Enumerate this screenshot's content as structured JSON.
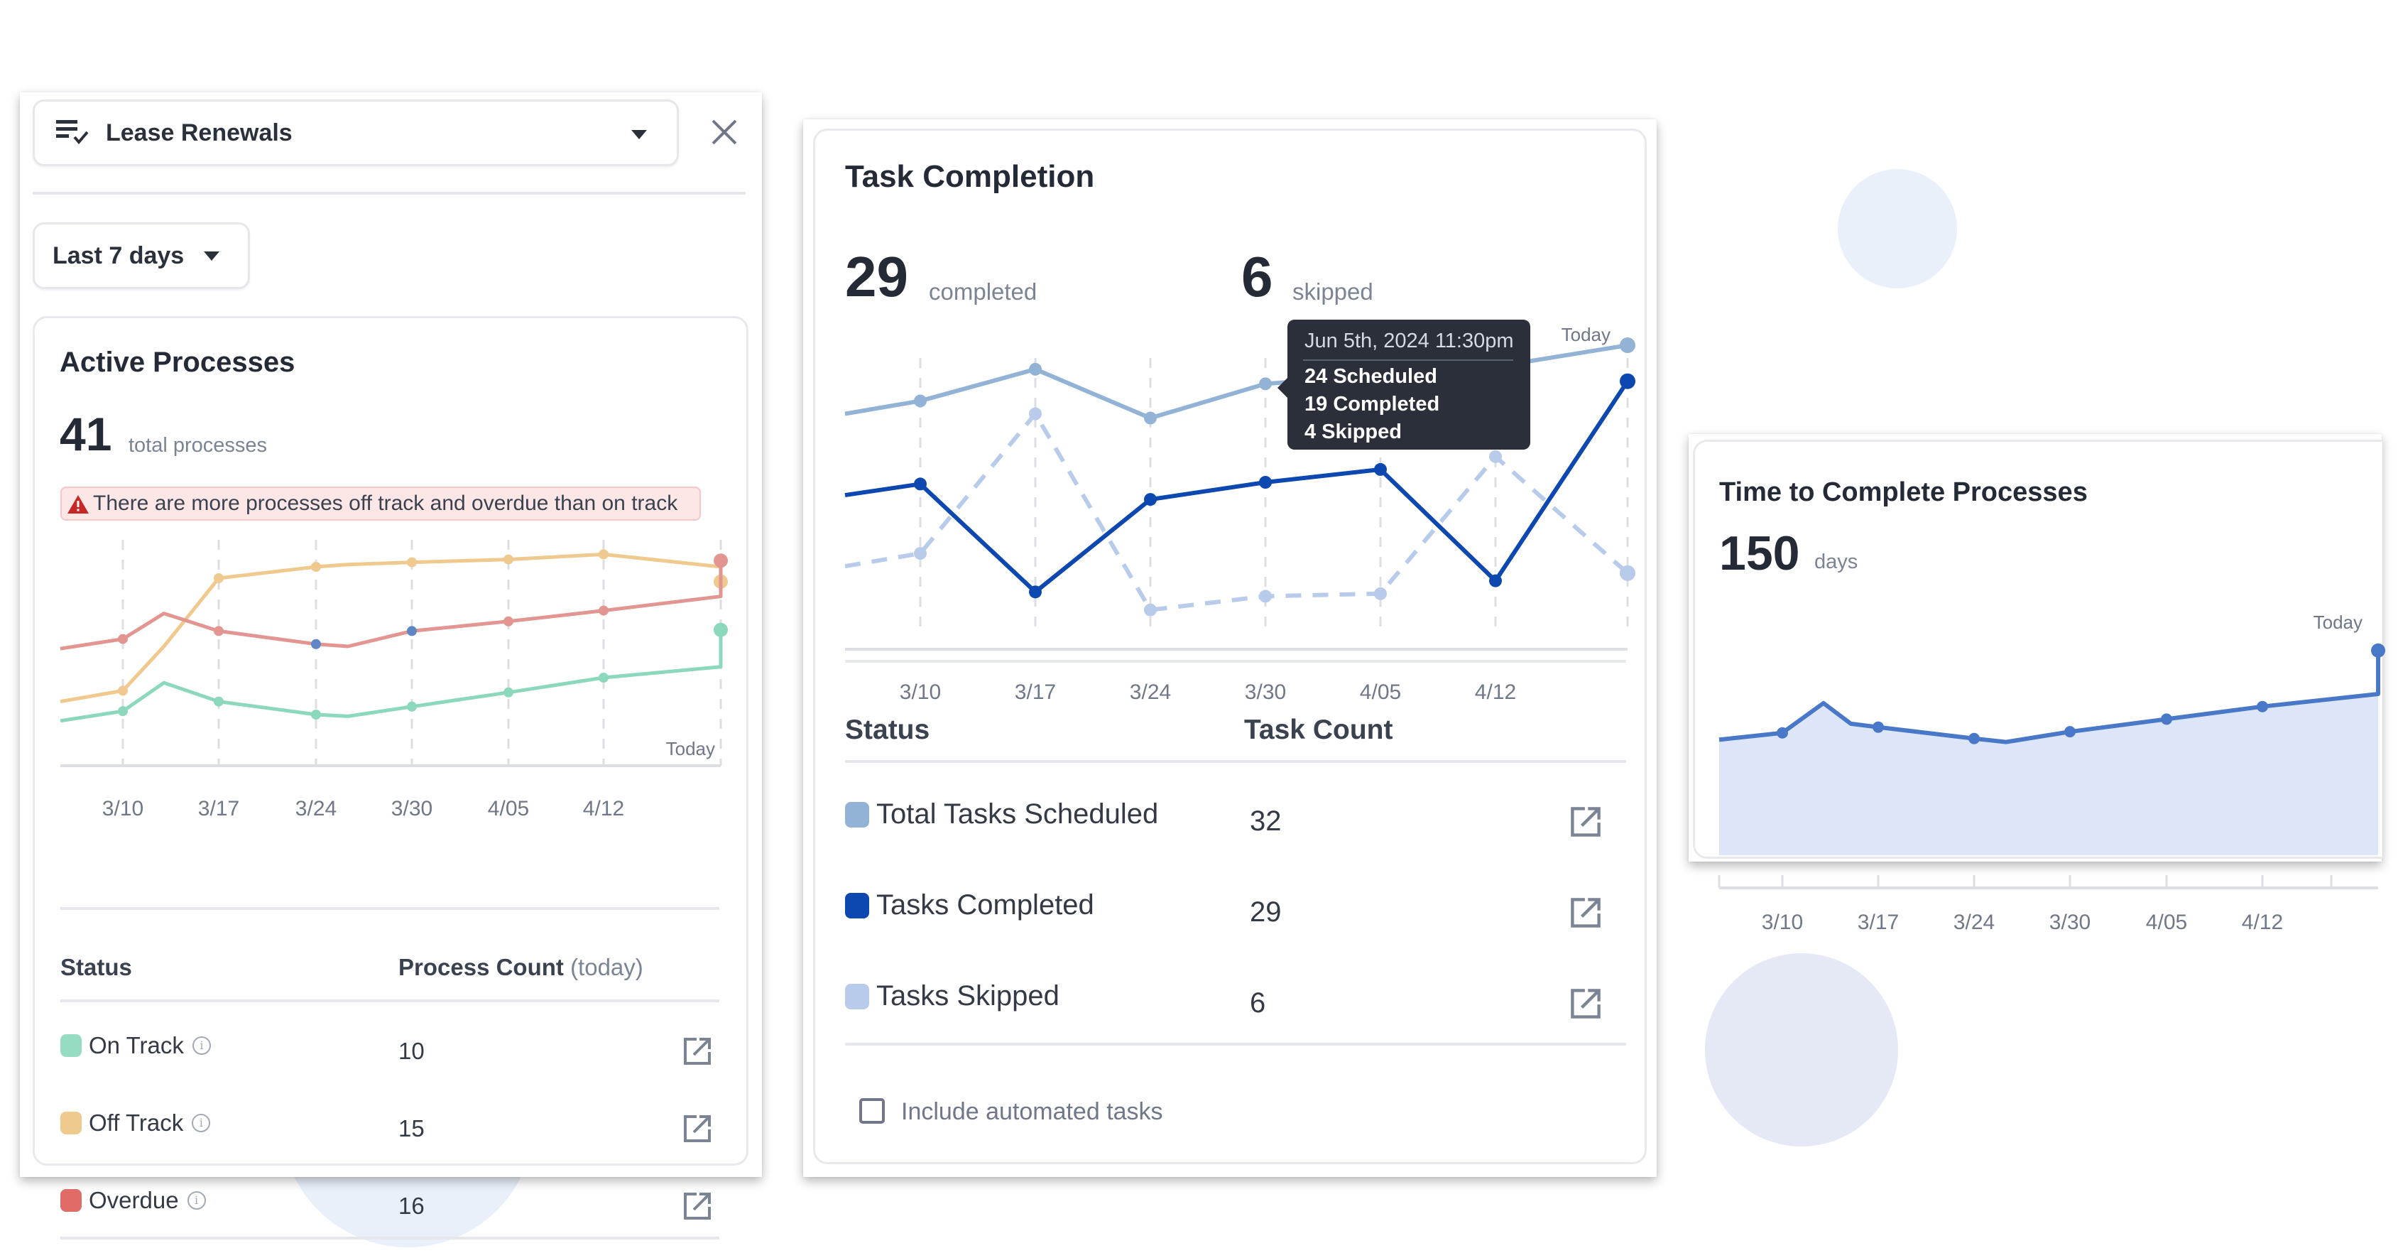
{
  "background": {
    "circle_color_a": "#e9f0fa",
    "circle_color_b": "#e4e9f5"
  },
  "left_panel": {
    "process_select": {
      "icon": "checklist-icon",
      "value": "Lease Renewals"
    },
    "close_icon": "close-icon",
    "range_select": {
      "value": "Last 7 days"
    },
    "active_processes": {
      "title": "Active Processes",
      "total_value": "41",
      "total_unit": "total processes",
      "alert": {
        "icon": "warning-triangle-icon",
        "text": "There are more processes off track and overdue than on track",
        "icon_color": "#c62828"
      },
      "table": {
        "headers": {
          "status": "Status",
          "count": "Process Count",
          "count_suffix": "(today)"
        },
        "rows": [
          {
            "label": "On Track",
            "count": "10",
            "color": "#96dcc1"
          },
          {
            "label": "Off Track",
            "count": "15",
            "color": "#f0c98e"
          },
          {
            "label": "Overdue",
            "count": "16",
            "color": "#e06b67"
          }
        ]
      }
    }
  },
  "middle_panel": {
    "title": "Task Completion",
    "completed_value": "29",
    "completed_unit": "completed",
    "skipped_value": "6",
    "skipped_unit": "skipped",
    "tooltip": {
      "date": "Jun 5th, 2024 11:30pm",
      "lines": [
        "24 Scheduled",
        "19 Completed",
        "4 Skipped"
      ]
    },
    "table": {
      "headers": {
        "status": "Status",
        "count": "Task Count"
      },
      "rows": [
        {
          "label": "Total Tasks Scheduled",
          "count": "32",
          "color": "#93b3d6"
        },
        {
          "label": "Tasks Completed",
          "count": "29",
          "color": "#0d47b0"
        },
        {
          "label": "Tasks Skipped",
          "count": "6",
          "color": "#b8cbea"
        }
      ]
    },
    "checkbox": {
      "label": "Include automated tasks",
      "checked": false
    }
  },
  "right_panel": {
    "title": "Time to Complete Processes",
    "value": "150",
    "unit": "days"
  },
  "chart_data": [
    {
      "id": "active_processes",
      "type": "line",
      "title": "Active Processes",
      "x": [
        "start",
        "3/10",
        "3/13",
        "3/17",
        "3/24",
        "3/26",
        "3/30",
        "4/05",
        "4/12",
        "4/17",
        "Today"
      ],
      "tick_labels": [
        "3/10",
        "3/17",
        "3/24",
        "3/30",
        "4/05",
        "4/12"
      ],
      "end_label": "Today",
      "ylim": [
        0,
        40
      ],
      "grid": "vertical-dashed",
      "series": [
        {
          "name": "Off Track",
          "color": "#f0c98e",
          "values": [
            11.3,
            13.2,
            21.0,
            33.0,
            35.0,
            35.4,
            35.8,
            36.3,
            37.2,
            35.0,
            32.4
          ]
        },
        {
          "name": "Overdue",
          "color": "#e39592",
          "values": [
            20.6,
            22.3,
            26.8,
            23.7,
            21.4,
            21.0,
            23.7,
            25.4,
            27.3,
            29.8,
            36.1
          ]
        },
        {
          "name": "On Track",
          "color": "#8cd8bd",
          "values": [
            7.9,
            9.6,
            14.6,
            11.3,
            9.0,
            8.7,
            10.4,
            12.9,
            15.5,
            17.4,
            23.9
          ]
        }
      ],
      "highlight_points": [
        {
          "series": "Overdue",
          "x": "3/24",
          "color": "#5f86c5"
        },
        {
          "series": "Overdue",
          "x": "3/30",
          "color": "#5f86c5"
        }
      ]
    },
    {
      "id": "task_completion",
      "type": "line",
      "title": "Task Completion",
      "x": [
        "start",
        "3/10",
        "3/17",
        "3/24",
        "3/30",
        "4/05",
        "4/12",
        "Today"
      ],
      "tick_labels": [
        "3/10",
        "3/17",
        "3/24",
        "3/30",
        "4/05",
        "4/12"
      ],
      "end_label": "Today",
      "ylim": [
        0,
        34
      ],
      "grid": "vertical-dashed",
      "series": [
        {
          "name": "Total Tasks Scheduled",
          "color": "#93b3d6",
          "style": "solid",
          "values": [
            25.0,
            26.5,
            30.2,
            24.5,
            28.5,
            29.5,
            30.5,
            33.0
          ]
        },
        {
          "name": "Tasks Completed",
          "color": "#0d47b0",
          "style": "solid",
          "values": [
            15.5,
            16.8,
            4.2,
            15.0,
            17.0,
            18.5,
            5.5,
            28.8
          ]
        },
        {
          "name": "Tasks Skipped",
          "color": "#b8cbea",
          "style": "dashed",
          "values": [
            7.2,
            8.7,
            25.0,
            2.1,
            3.7,
            4.0,
            20.0,
            6.4
          ]
        }
      ]
    },
    {
      "id": "time_to_complete",
      "type": "area",
      "title": "Time to Complete Processes",
      "x": [
        "start",
        "3/10",
        "3/13",
        "3/15",
        "3/17",
        "3/24",
        "3/26",
        "3/30",
        "4/05",
        "4/12",
        "4/17",
        "Today"
      ],
      "tick_labels": [
        "3/10",
        "3/17",
        "3/24",
        "3/30",
        "4/05",
        "4/12"
      ],
      "end_label": "Today",
      "ylim": [
        0,
        200
      ],
      "series": [
        {
          "name": "Days",
          "color": "#4a78c8",
          "fill": "#dce6f8",
          "values": [
            101,
            107,
            133,
            115,
            112,
            102,
            99,
            108,
            119,
            130,
            141,
            179
          ]
        }
      ]
    }
  ]
}
